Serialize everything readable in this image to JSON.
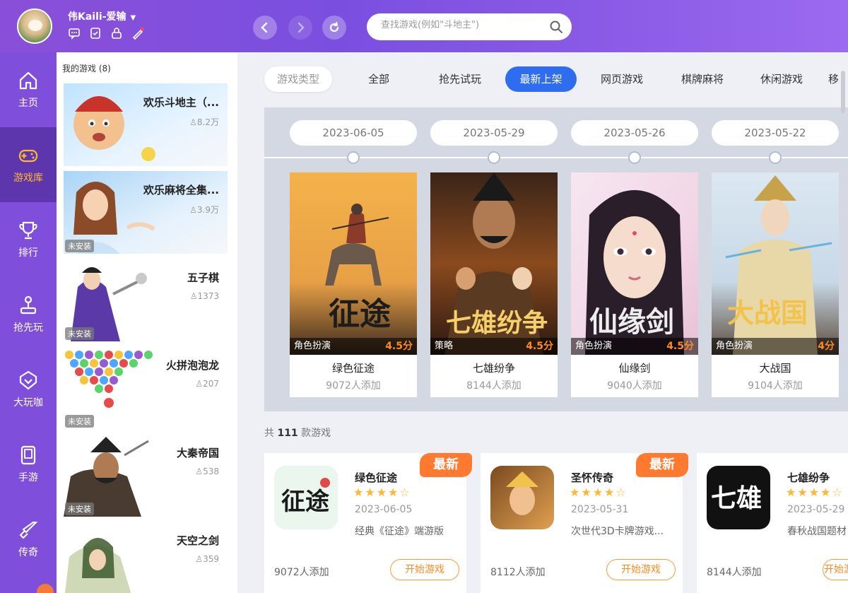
{
  "header": {
    "username": "伟Kaili-爱输",
    "search_placeholder": "查找游戏(例如\"斗地主\")"
  },
  "sidebar": {
    "items": [
      {
        "label": "主页",
        "icon": "home-icon"
      },
      {
        "label": "游戏库",
        "icon": "gamepad-icon"
      },
      {
        "label": "排行",
        "icon": "trophy-icon"
      },
      {
        "label": "抢先玩",
        "icon": "joystick-icon"
      },
      {
        "label": "大玩咖",
        "icon": "vip-icon"
      },
      {
        "label": "手游",
        "icon": "tablet-icon"
      },
      {
        "label": "传奇",
        "icon": "sword-icon"
      }
    ]
  },
  "my_games": {
    "title": "我的游戏 (8)",
    "items": [
      {
        "name": "欢乐斗地主（...",
        "count": "8.2万",
        "badge": ""
      },
      {
        "name": "欢乐麻将全集...",
        "count": "3.9万",
        "badge": "未安装"
      },
      {
        "name": "五子棋",
        "count": "1373",
        "badge": "未安装"
      },
      {
        "name": "火拼泡泡龙",
        "count": "207",
        "badge": "未安装"
      },
      {
        "name": "大秦帝国",
        "count": "538",
        "badge": "未安装"
      },
      {
        "name": "天空之剑",
        "count": "359",
        "badge": ""
      }
    ]
  },
  "tabs": {
    "type_label": "游戏类型",
    "items": [
      "全部",
      "抢先试玩",
      "最新上架",
      "网页游戏",
      "棋牌麻将",
      "休闲游戏",
      "移"
    ]
  },
  "timeline": {
    "cards": [
      {
        "date": "2023-06-05",
        "genre": "角色扮演",
        "score": "4.5分",
        "name": "绿色征途",
        "plays": "9072人添加"
      },
      {
        "date": "2023-05-29",
        "genre": "策略",
        "score": "4.5分",
        "name": "七雄纷争",
        "plays": "8144人添加"
      },
      {
        "date": "2023-05-26",
        "genre": "角色扮演",
        "score": "4.5分",
        "name": "仙缘剑",
        "plays": "9040人添加"
      },
      {
        "date": "2023-05-22",
        "genre": "角色扮演",
        "score": "4分",
        "name": "大战国",
        "plays": "9104人添加"
      }
    ]
  },
  "total": {
    "prefix": "共",
    "count": "111",
    "suffix": "款游戏"
  },
  "game_cards": [
    {
      "name": "绿色征途",
      "date": "2023-06-05",
      "desc": "经典《征途》端游版",
      "plays": "9072人添加",
      "new_badge": "最新",
      "button": "开始游戏",
      "stars": "★★★★☆"
    },
    {
      "name": "圣怀传奇",
      "date": "2023-05-31",
      "desc": "次世代3D卡牌游戏...",
      "plays": "8112人添加",
      "new_badge": "最新",
      "button": "开始游戏",
      "stars": "★★★★☆"
    },
    {
      "name": "七雄纷争",
      "date": "2023-05-29",
      "desc": "春秋战国题材",
      "plays": "8144人添加",
      "new_badge": "",
      "button": "开始游戏",
      "stars": "★★★★☆"
    }
  ],
  "colors": {
    "brand_purple": "#7f4fdc",
    "active_tab": "#2f6df0",
    "accent_orange": "#ff7a2f"
  }
}
